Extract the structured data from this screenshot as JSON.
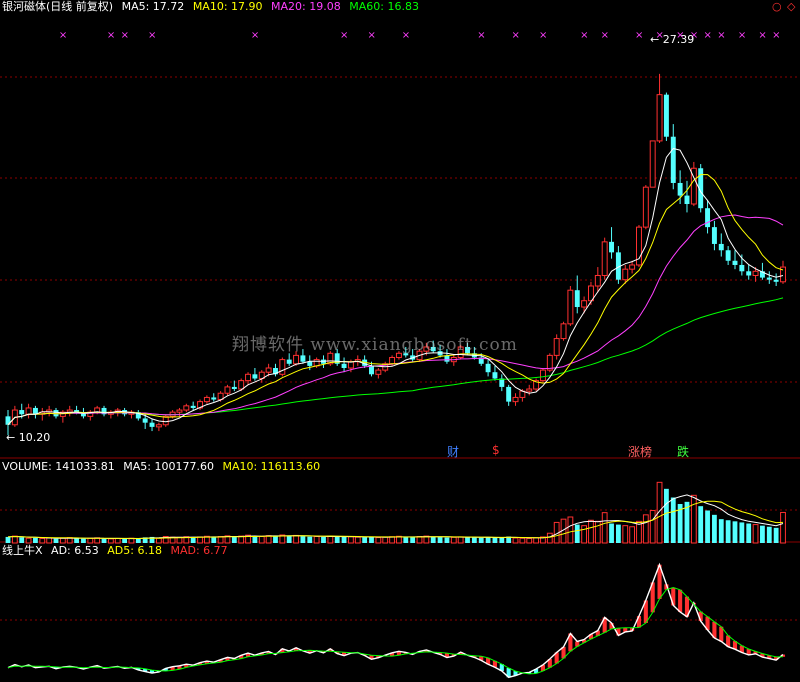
{
  "header": {
    "title": "银河磁体(日线 前复权)",
    "ma5": "MA5: 17.72",
    "ma10": "MA10: 17.90",
    "ma20": "MA20: 19.08",
    "ma60": "MA60: 16.83",
    "corner_icons": [
      "circle-icon",
      "diamond-icon"
    ]
  },
  "volume_header": {
    "title": "VOLUME: 141033.81",
    "ma5": "MA5: 100177.60",
    "ma10": "MA10: 116113.60"
  },
  "indicator_header": {
    "title": "线上牛X",
    "ad": "AD: 6.53",
    "ad5": "AD5: 6.18",
    "mad": "MAD: 6.77"
  },
  "watermark": "翔博软件 www.xiangbosoft.com",
  "annotations": {
    "high": "27.39",
    "low": "10.20"
  },
  "events": [
    {
      "label": "财",
      "color": "#4080ff"
    },
    {
      "label": "$",
      "color": "#ff3030"
    },
    {
      "label": "涨榜",
      "color": "#ff6060"
    },
    {
      "label": "跌",
      "color": "#40ff40"
    }
  ],
  "colors": {
    "up": "#ff3030",
    "down": "#54ffff",
    "ma5": "#ffffff",
    "ma10": "#ffff00",
    "ma20": "#ff40ff",
    "ma60": "#00ff00",
    "grid": "#8b0000",
    "marker": "#ff40ff"
  },
  "chart_data": {
    "type": "candlestick",
    "price_range": [
      9.5,
      29.0
    ],
    "candles": [
      [
        11.1,
        11.4,
        10.2,
        10.7
      ],
      [
        10.7,
        11.6,
        10.6,
        11.4
      ],
      [
        11.4,
        11.7,
        11.0,
        11.2
      ],
      [
        11.2,
        11.7,
        11.0,
        11.5
      ],
      [
        11.5,
        11.6,
        11.0,
        11.2
      ],
      [
        11.2,
        11.5,
        10.9,
        11.3
      ],
      [
        11.3,
        11.6,
        11.1,
        11.4
      ],
      [
        11.4,
        11.5,
        11.0,
        11.1
      ],
      [
        11.1,
        11.4,
        10.8,
        11.3
      ],
      [
        11.3,
        11.6,
        11.1,
        11.4
      ],
      [
        11.4,
        11.6,
        11.2,
        11.3
      ],
      [
        11.3,
        11.5,
        11.0,
        11.1
      ],
      [
        11.1,
        11.4,
        10.9,
        11.3
      ],
      [
        11.3,
        11.6,
        11.2,
        11.5
      ],
      [
        11.5,
        11.6,
        11.1,
        11.2
      ],
      [
        11.2,
        11.4,
        11.0,
        11.3
      ],
      [
        11.3,
        11.5,
        11.1,
        11.4
      ],
      [
        11.4,
        11.5,
        11.1,
        11.2
      ],
      [
        11.2,
        11.4,
        11.0,
        11.3
      ],
      [
        11.3,
        11.4,
        10.9,
        11.0
      ],
      [
        11.0,
        11.2,
        10.5,
        10.8
      ],
      [
        10.8,
        11.0,
        10.4,
        10.6
      ],
      [
        10.6,
        10.8,
        10.4,
        10.7
      ],
      [
        10.7,
        11.2,
        10.6,
        11.1
      ],
      [
        11.1,
        11.4,
        11.0,
        11.3
      ],
      [
        11.3,
        11.5,
        11.1,
        11.4
      ],
      [
        11.4,
        11.7,
        11.3,
        11.6
      ],
      [
        11.6,
        11.8,
        11.4,
        11.5
      ],
      [
        11.5,
        11.9,
        11.4,
        11.8
      ],
      [
        11.8,
        12.1,
        11.7,
        12.0
      ],
      [
        12.0,
        12.2,
        11.8,
        11.9
      ],
      [
        11.9,
        12.3,
        11.8,
        12.2
      ],
      [
        12.2,
        12.6,
        12.1,
        12.5
      ],
      [
        12.5,
        12.8,
        12.3,
        12.4
      ],
      [
        12.4,
        12.9,
        12.3,
        12.8
      ],
      [
        12.8,
        13.2,
        12.6,
        13.1
      ],
      [
        13.1,
        13.4,
        12.8,
        12.9
      ],
      [
        12.9,
        13.3,
        12.7,
        13.2
      ],
      [
        13.2,
        13.6,
        13.0,
        13.4
      ],
      [
        13.4,
        13.6,
        13.0,
        13.1
      ],
      [
        13.1,
        13.9,
        13.0,
        13.8
      ],
      [
        13.8,
        14.1,
        13.5,
        13.6
      ],
      [
        13.6,
        14.2,
        13.5,
        14.0
      ],
      [
        14.0,
        14.3,
        13.6,
        13.7
      ],
      [
        13.7,
        14.0,
        13.3,
        13.5
      ],
      [
        13.5,
        13.9,
        13.4,
        13.8
      ],
      [
        13.8,
        14.0,
        13.4,
        13.6
      ],
      [
        13.6,
        14.2,
        13.5,
        14.1
      ],
      [
        14.1,
        14.3,
        13.5,
        13.6
      ],
      [
        13.6,
        13.9,
        13.2,
        13.4
      ],
      [
        13.4,
        13.8,
        13.2,
        13.7
      ],
      [
        13.7,
        14.0,
        13.5,
        13.8
      ],
      [
        13.8,
        14.0,
        13.4,
        13.5
      ],
      [
        13.5,
        13.7,
        13.0,
        13.1
      ],
      [
        13.1,
        13.4,
        12.9,
        13.3
      ],
      [
        13.3,
        13.7,
        13.2,
        13.6
      ],
      [
        13.6,
        14.0,
        13.5,
        13.9
      ],
      [
        13.9,
        14.2,
        13.8,
        14.1
      ],
      [
        14.1,
        14.4,
        13.9,
        14.0
      ],
      [
        14.0,
        14.3,
        13.7,
        13.8
      ],
      [
        13.8,
        14.3,
        13.7,
        14.2
      ],
      [
        14.2,
        14.6,
        14.0,
        14.4
      ],
      [
        14.4,
        14.7,
        14.1,
        14.2
      ],
      [
        14.2,
        14.5,
        13.9,
        14.0
      ],
      [
        14.0,
        14.3,
        13.6,
        13.7
      ],
      [
        13.7,
        14.0,
        13.5,
        13.9
      ],
      [
        13.9,
        14.5,
        13.8,
        14.4
      ],
      [
        14.4,
        14.6,
        14.0,
        14.1
      ],
      [
        14.1,
        14.4,
        13.8,
        13.9
      ],
      [
        13.9,
        14.1,
        13.5,
        13.6
      ],
      [
        13.6,
        13.8,
        13.0,
        13.2
      ],
      [
        13.2,
        13.5,
        12.8,
        12.9
      ],
      [
        12.9,
        13.1,
        12.3,
        12.5
      ],
      [
        12.5,
        12.6,
        11.6,
        11.8
      ],
      [
        11.8,
        12.2,
        11.6,
        12.0
      ],
      [
        12.0,
        12.4,
        11.8,
        12.3
      ],
      [
        12.3,
        12.6,
        12.1,
        12.4
      ],
      [
        12.4,
        12.9,
        12.3,
        12.8
      ],
      [
        12.8,
        13.4,
        12.7,
        13.3
      ],
      [
        13.3,
        14.1,
        13.2,
        14.0
      ],
      [
        14.0,
        15.0,
        13.8,
        14.8
      ],
      [
        14.8,
        15.6,
        14.7,
        15.5
      ],
      [
        15.5,
        17.3,
        15.4,
        17.1
      ],
      [
        17.1,
        17.8,
        16.0,
        16.3
      ],
      [
        16.3,
        16.8,
        16.0,
        16.6
      ],
      [
        16.6,
        17.5,
        16.4,
        17.3
      ],
      [
        17.3,
        18.2,
        17.0,
        17.8
      ],
      [
        17.8,
        19.6,
        17.6,
        19.4
      ],
      [
        19.4,
        20.1,
        18.6,
        18.9
      ],
      [
        18.9,
        19.2,
        17.4,
        17.6
      ],
      [
        17.6,
        18.3,
        17.4,
        18.1
      ],
      [
        18.1,
        18.5,
        17.9,
        18.3
      ],
      [
        18.3,
        20.2,
        18.2,
        20.1
      ],
      [
        20.1,
        22.1,
        20.0,
        22.0
      ],
      [
        22.0,
        24.2,
        22.0,
        24.2
      ],
      [
        24.2,
        27.39,
        24.1,
        26.4
      ],
      [
        26.4,
        26.5,
        24.2,
        24.4
      ],
      [
        24.4,
        25.0,
        21.9,
        22.2
      ],
      [
        22.2,
        22.8,
        21.2,
        21.6
      ],
      [
        21.6,
        22.3,
        20.8,
        21.2
      ],
      [
        21.2,
        23.2,
        21.1,
        22.9
      ],
      [
        22.9,
        23.1,
        20.8,
        21.0
      ],
      [
        21.0,
        21.4,
        19.8,
        20.1
      ],
      [
        20.1,
        20.4,
        19.0,
        19.3
      ],
      [
        19.3,
        19.8,
        18.7,
        19.0
      ],
      [
        19.0,
        19.2,
        18.3,
        18.5
      ],
      [
        18.5,
        19.0,
        18.1,
        18.3
      ],
      [
        18.3,
        18.8,
        17.8,
        18.0
      ],
      [
        18.0,
        18.3,
        17.6,
        17.8
      ],
      [
        17.8,
        18.2,
        17.5,
        18.0
      ],
      [
        18.0,
        18.4,
        17.6,
        17.7
      ],
      [
        17.7,
        18.0,
        17.4,
        17.6
      ],
      [
        17.6,
        17.9,
        17.3,
        17.5
      ],
      [
        17.5,
        18.5,
        17.4,
        18.2
      ]
    ],
    "volume_range": [
      0,
      300000
    ],
    "volumes": [
      28000,
      32000,
      26000,
      22000,
      24000,
      21000,
      23000,
      20000,
      22000,
      25000,
      21000,
      20000,
      22000,
      24000,
      20000,
      19000,
      21000,
      20000,
      22000,
      21000,
      26000,
      28000,
      22000,
      30000,
      27000,
      26000,
      29000,
      25000,
      28000,
      31000,
      27000,
      30000,
      33000,
      29000,
      32000,
      36000,
      31000,
      30000,
      34000,
      32000,
      37000,
      33000,
      35000,
      31000,
      29000,
      30000,
      28000,
      32000,
      30000,
      28000,
      29000,
      27000,
      26000,
      28000,
      25000,
      27000,
      29000,
      31000,
      28000,
      26000,
      30000,
      32000,
      29000,
      27000,
      25000,
      26000,
      28000,
      27000,
      25000,
      24000,
      27000,
      25000,
      24000,
      30000,
      23000,
      22000,
      21000,
      24000,
      28000,
      45000,
      95000,
      110000,
      120000,
      85000,
      80000,
      105000,
      100000,
      140000,
      90000,
      85000,
      80000,
      75000,
      100000,
      130000,
      150000,
      280000,
      250000,
      210000,
      180000,
      190000,
      220000,
      170000,
      150000,
      130000,
      110000,
      105000,
      100000,
      95000,
      90000,
      85000,
      80000,
      75000,
      70000,
      141033.81
    ],
    "indicator": {
      "name": "线上牛X",
      "ad": 6.53,
      "ad5": 6.18,
      "mad": 6.77
    }
  }
}
